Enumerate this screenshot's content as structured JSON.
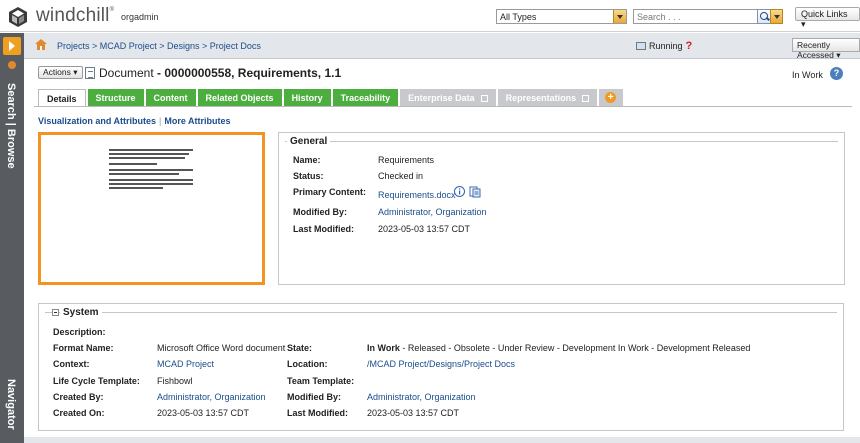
{
  "app": {
    "brand": "windchill",
    "user": "orgadmin"
  },
  "header": {
    "type_filter": "All Types",
    "search_placeholder": "Search . . .",
    "quick_links": "Quick Links"
  },
  "nav_rail": {
    "search_browse": "Search | Browse",
    "navigator": "Navigator"
  },
  "breadcrumb": {
    "path": "Projects > MCAD Project > Designs > Project Docs",
    "running_label": "Running",
    "recently_accessed": "Recently Accessed"
  },
  "object": {
    "actions_label": "Actions",
    "type_label": "Document",
    "title": "- 0000000558, Requirements, 1.1",
    "state_badge": "In Work"
  },
  "tabs": [
    {
      "label": "Details"
    },
    {
      "label": "Structure"
    },
    {
      "label": "Content"
    },
    {
      "label": "Related Objects"
    },
    {
      "label": "History"
    },
    {
      "label": "Traceability"
    },
    {
      "label": "Enterprise Data"
    },
    {
      "label": "Representations"
    }
  ],
  "sublinks": {
    "viz": "Visualization and Attributes",
    "more": "More Attributes"
  },
  "general": {
    "heading": "General",
    "name_label": "Name:",
    "name_value": "Requirements",
    "status_label": "Status:",
    "status_value": "Checked in",
    "primary_label": "Primary Content:",
    "primary_value": "Requirements.docx",
    "modified_by_label": "Modified By:",
    "modified_by_value": "Administrator, Organization",
    "last_modified_label": "Last Modified:",
    "last_modified_value": "2023-05-03 13:57 CDT"
  },
  "system": {
    "heading": "System",
    "description_label": "Description:",
    "format_label": "Format Name:",
    "format_value": "Microsoft Office Word document",
    "context_label": "Context:",
    "context_value": "MCAD Project",
    "lifecycle_label": "Life Cycle Template:",
    "lifecycle_value": "Fishbowl",
    "created_by_label": "Created By:",
    "created_by_value": "Administrator, Organization",
    "created_on_label": "Created On:",
    "created_on_value": "2023-05-03 13:57 CDT",
    "state_label": "State:",
    "state_current": "In Work",
    "state_rest": " - Released - Obsolete - Under Review - Development In Work - Development Released",
    "location_label": "Location:",
    "location_value": "/MCAD Project/Designs/Project Docs",
    "team_label": "Team Template:",
    "modified_by_label": "Modified By:",
    "modified_by_value": "Administrator, Organization",
    "last_modified_label": "Last Modified:",
    "last_modified_value": "2023-05-03 13:57 CDT"
  }
}
